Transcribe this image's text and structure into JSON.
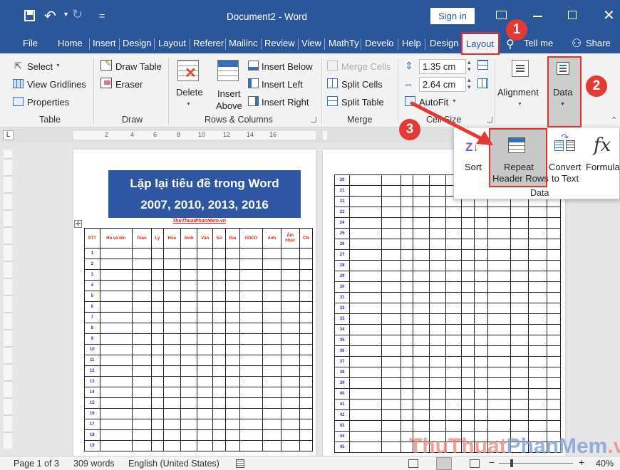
{
  "window": {
    "title": "Document2 - Word",
    "sign_in": "Sign in"
  },
  "tabs": [
    {
      "label": "File"
    },
    {
      "label": "Home"
    },
    {
      "label": "Insert"
    },
    {
      "label": "Design"
    },
    {
      "label": "Layout"
    },
    {
      "label": "Referer"
    },
    {
      "label": "Mailinc"
    },
    {
      "label": "Review"
    },
    {
      "label": "View"
    },
    {
      "label": "MathTy"
    },
    {
      "label": "Develo"
    },
    {
      "label": "Help"
    },
    {
      "label": "Design"
    },
    {
      "label": "Layout"
    }
  ],
  "tell_me": "Tell me",
  "share": "Share",
  "ribbon": {
    "table": {
      "select": "Select",
      "view_gridlines": "View Gridlines",
      "properties": "Properties",
      "label": "Table"
    },
    "draw": {
      "draw_table": "Draw Table",
      "eraser": "Eraser",
      "label": "Draw"
    },
    "rows_cols": {
      "delete": "Delete",
      "insert_above_1": "Insert",
      "insert_above_2": "Above",
      "insert_below": "Insert Below",
      "insert_left": "Insert Left",
      "insert_right": "Insert Right",
      "label": "Rows & Columns"
    },
    "merge": {
      "merge_cells": "Merge Cells",
      "split_cells": "Split Cells",
      "split_table": "Split Table",
      "label": "Merge"
    },
    "cell_size": {
      "height": "1.35 cm",
      "width": "2.64 cm",
      "autofit": "AutoFit",
      "label": "Cell Size"
    },
    "alignment": "Alignment",
    "data": "Data"
  },
  "data_popup": {
    "sort": "Sort",
    "repeat_1": "Repeat",
    "repeat_2": "Header Rows",
    "convert_1": "Convert",
    "convert_2": "to Text",
    "formula": "Formula",
    "label": "Data"
  },
  "callouts": [
    "1",
    "2",
    "3"
  ],
  "document": {
    "title_line1": "Lặp lại tiêu đề trong Word",
    "title_line2": "2007, 2010, 2013, 2016",
    "site": "ThuThuatPhanMem.vn",
    "headers": [
      "STT",
      "Họ và tên",
      "Toán",
      "Lý",
      "Hóa",
      "Sinh",
      "Văn",
      "Sử",
      "Địa",
      "GDCD",
      "Anh",
      "Âm nhạc",
      "CN"
    ],
    "page1_rows": [
      "1",
      "2",
      "3",
      "4",
      "5",
      "6",
      "7",
      "8",
      "9",
      "10",
      "11",
      "12",
      "13",
      "14",
      "15",
      "16",
      "17",
      "18",
      "19"
    ],
    "page2_rows": [
      "20",
      "21",
      "22",
      "23",
      "24",
      "25",
      "26",
      "27",
      "28",
      "29",
      "30",
      "31",
      "32",
      "33",
      "34",
      "35",
      "36",
      "37",
      "38",
      "39",
      "40",
      "41",
      "42",
      "43",
      "44",
      "45"
    ]
  },
  "ruler_marks": [
    "2",
    "4",
    "6",
    "8",
    "10",
    "12",
    "14",
    "16"
  ],
  "status": {
    "page": "Page 1 of 3",
    "words": "309 words",
    "language": "English (United States)",
    "zoom": "40%"
  },
  "watermark": {
    "part1": "ThuThuat",
    "part2": "PhanMem",
    "part3": ".vn"
  },
  "colors": {
    "accent": "#2b579a",
    "callout": "#e53935",
    "header_fill": "#2e56a5",
    "table_text": "#e0241b"
  }
}
